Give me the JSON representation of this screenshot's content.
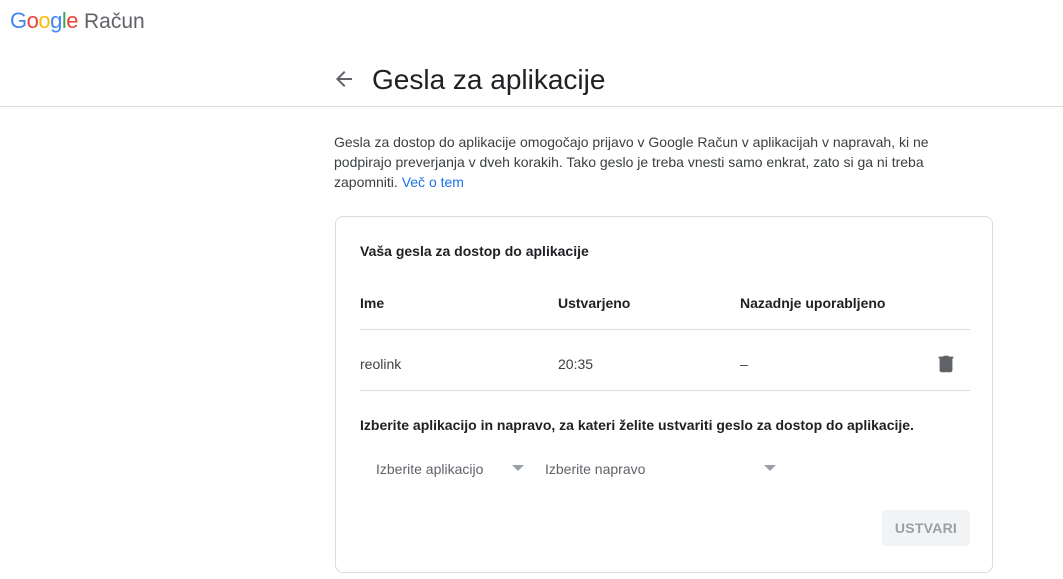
{
  "header": {
    "logo_text": [
      "G",
      "o",
      "o",
      "g",
      "l",
      "e"
    ],
    "logo_colors": [
      "#4285F4",
      "#EA4335",
      "#FBBC05",
      "#4285F4",
      "#34A853",
      "#EA4335"
    ],
    "product": "Račun"
  },
  "page": {
    "title": "Gesla za aplikacije",
    "description": "Gesla za dostop do aplikacije omogočajo prijavo v Google Račun v aplikacijah v napravah, ki ne podpirajo preverjanja v dveh korakih. Tako geslo je treba vnesti samo enkrat, zato si ga ni treba zapomniti.",
    "learn_more": "Več o tem"
  },
  "card": {
    "title": "Vaša gesla za dostop do aplikacije",
    "columns": {
      "name": "Ime",
      "created": "Ustvarjeno",
      "last_used": "Nazadnje uporabljeno"
    },
    "rows": [
      {
        "name": "reolink",
        "created": "20:35",
        "last_used": "–"
      }
    ],
    "create_title": "Izberite aplikacijo in napravo, za kateri želite ustvariti geslo za dostop do aplikacije.",
    "select_app": "Izberite aplikacijo",
    "select_device": "Izberite napravo",
    "create_button": "USTVARI"
  },
  "icons": {
    "back": "arrow-left-icon",
    "delete": "trash-icon"
  },
  "colors": {
    "link": "#1a73e8",
    "divider": "#dadce0",
    "disabled_text": "#9aa0a6"
  }
}
